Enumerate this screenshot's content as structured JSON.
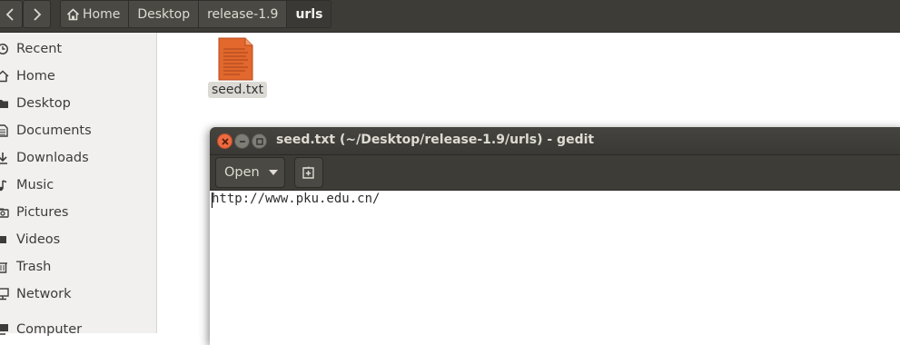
{
  "file_manager": {
    "breadcrumbs": [
      {
        "label": "Home"
      },
      {
        "label": "Desktop"
      },
      {
        "label": "release-1.9"
      },
      {
        "label": "urls"
      }
    ],
    "sidebar": {
      "items": [
        {
          "label": "Recent",
          "icon": "clock-icon"
        },
        {
          "label": "Home",
          "icon": "home-icon"
        },
        {
          "label": "Desktop",
          "icon": "folder-icon"
        },
        {
          "label": "Documents",
          "icon": "document-icon"
        },
        {
          "label": "Downloads",
          "icon": "download-icon"
        },
        {
          "label": "Music",
          "icon": "music-icon"
        },
        {
          "label": "Pictures",
          "icon": "camera-icon"
        },
        {
          "label": "Videos",
          "icon": "video-icon"
        },
        {
          "label": "Trash",
          "icon": "trash-icon"
        },
        {
          "label": "Network",
          "icon": "network-icon"
        },
        {
          "label": "Computer",
          "icon": "computer-icon"
        }
      ]
    },
    "files": [
      {
        "name": "seed.txt",
        "icon": "text-file-icon"
      }
    ]
  },
  "gedit": {
    "title": "seed.txt (~/Desktop/release-1.9/urls) - gedit",
    "open_label": "Open",
    "editor_text": "http://www.pku.edu.cn/"
  },
  "colors": {
    "titlebar": "#3d3c37",
    "close_button": "#ee6a40",
    "file_icon": "#e2682d"
  }
}
